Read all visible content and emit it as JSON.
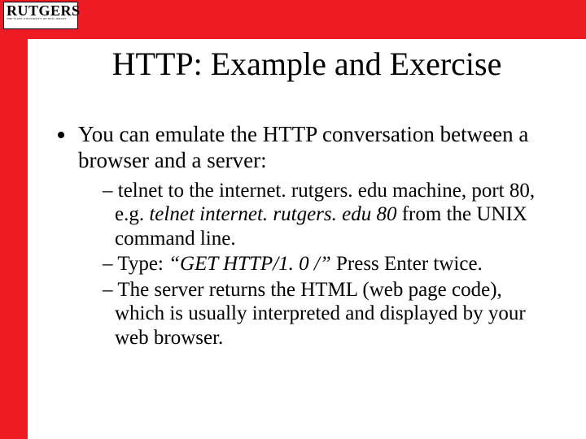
{
  "logo": {
    "main": "RUTGERS",
    "sub": "THE STATE UNIVERSITY OF NEW JERSEY"
  },
  "title": "HTTP:  Example and Exercise",
  "bullet": "You can emulate the HTTP conversation between a browser and a server:",
  "sub1_a": "telnet to the internet. rutgers. edu machine,  port 80, e.g. ",
  "sub1_b": "telnet internet. rutgers. edu 80",
  "sub1_c": " from the UNIX command line.",
  "sub2_a": "Type:  ",
  "sub2_b": "“GET HTTP/1. 0 /”",
  "sub2_c": "  Press Enter twice.",
  "sub3": "The server returns the HTML (web page code), which is usually interpreted and displayed by your web browser."
}
